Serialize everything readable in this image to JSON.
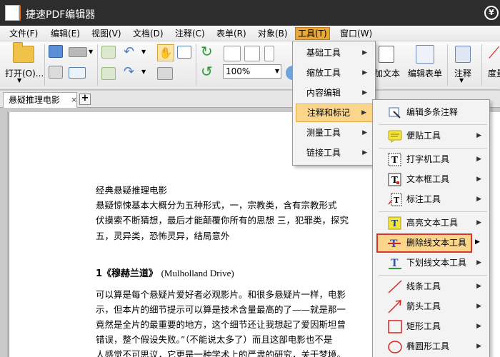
{
  "window": {
    "title": "捷速PDF编辑器",
    "logo_letter": "P",
    "yen_symbol": "¥"
  },
  "menubar": {
    "items": [
      {
        "label": "文件(F)"
      },
      {
        "label": "编辑(E)"
      },
      {
        "label": "视图(V)"
      },
      {
        "label": "文档(D)"
      },
      {
        "label": "注释(C)"
      },
      {
        "label": "表单(R)"
      },
      {
        "label": "对象(B)"
      },
      {
        "label": "工具(T)"
      },
      {
        "label": "窗口(W)"
      }
    ],
    "active_index": 7
  },
  "toolbar": {
    "open_label": "打开(O)...",
    "zoom_value": "100%",
    "add_text_label": "加文本",
    "edit_form_label": "编辑表单",
    "annotate_label": "注释",
    "measure_label": "度量"
  },
  "tabs": [
    {
      "label": "悬疑推理电影",
      "close": "×"
    }
  ],
  "tab_add_symbol": "+",
  "document": {
    "lines": [
      "经典悬疑推理电影",
      "悬疑惊悚基本大概分为五种形式，一，宗教类，含有宗教形式",
      "伏摸索不断猜想，最后才能颠覆你所有的思想  三，犯罪类，探究",
      "五，灵异类，恐怖灵异，结局意外"
    ],
    "heading_cn": "1《穆赫兰道》",
    "heading_en": "(Mulholland Drive)",
    "body": [
      "可以算是每个悬疑片爱好者必观影片。和很多悬疑片一样，电影",
      "示，但本片的细节提示可以算是技术含量最高的了——就是那一",
      "竟然是全片的最重要的地方，这个细节还让我想起了爱因斯坦曾",
      "错误，整个假设失败。”（不能说太多了）而且这部电影也不是",
      "人感觉不可思议，它更是一种学术上的严肃的研究，关于梦境。"
    ]
  },
  "tools_menu": {
    "items": [
      {
        "label": "基础工具",
        "arrow": "▶"
      },
      {
        "label": "缩放工具",
        "arrow": "▶"
      },
      {
        "label": "内容编辑",
        "arrow": "▶"
      },
      {
        "label": "注释和标记",
        "arrow": "▶"
      },
      {
        "label": "测量工具",
        "arrow": "▶"
      },
      {
        "label": "链接工具",
        "arrow": "▶"
      }
    ],
    "highlighted_index": 3
  },
  "annotation_menu": {
    "items": [
      {
        "label": "编辑多条注释",
        "icon": "edit-annotations-icon",
        "arrow": ""
      },
      {
        "label": "便贴工具",
        "icon": "sticky-note-icon",
        "arrow": "▶"
      },
      {
        "label": "打字机工具",
        "icon": "typewriter-icon",
        "arrow": "▶"
      },
      {
        "label": "文本框工具",
        "icon": "textbox-icon",
        "arrow": "▶"
      },
      {
        "label": "标注工具",
        "icon": "callout-icon",
        "arrow": "▶"
      },
      {
        "label": "高亮文本工具",
        "icon": "highlight-text-icon",
        "arrow": "▶"
      },
      {
        "label": "删除线文本工具",
        "icon": "strikethrough-text-icon",
        "arrow": "▶"
      },
      {
        "label": "下划线文本工具",
        "icon": "underline-text-icon",
        "arrow": "▶"
      },
      {
        "label": "线条工具",
        "icon": "line-icon",
        "arrow": "▶"
      },
      {
        "label": "箭头工具",
        "icon": "arrow-tool-icon",
        "arrow": "▶"
      },
      {
        "label": "矩形工具",
        "icon": "rectangle-icon",
        "arrow": "▶"
      },
      {
        "label": "椭圆形工具",
        "icon": "ellipse-icon",
        "arrow": "▶"
      }
    ],
    "highlighted_index": 6
  },
  "colors": {
    "accent": "#e8a83a",
    "highlight_border": "#d9362a",
    "titlebar": "#2d2d2d"
  }
}
